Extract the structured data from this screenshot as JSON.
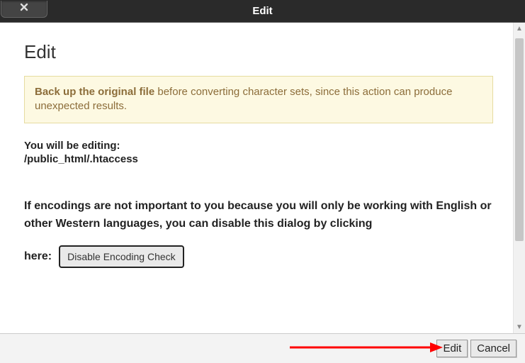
{
  "titlebar": {
    "title": "Edit"
  },
  "dialog": {
    "heading": "Edit",
    "warning_bold": "Back up the original file",
    "warning_rest": " before converting character sets, since this action can produce unexpected results.",
    "editing_label": "You will be editing:",
    "file_path": "/public_html/.htaccess",
    "encoding_msg": "If encodings are not important to you because you will only be working with English or other Western languages, you can disable this dialog by clicking",
    "here_label": "here:",
    "disable_btn": "Disable Encoding Check"
  },
  "footer": {
    "edit": "Edit",
    "cancel": "Cancel"
  }
}
